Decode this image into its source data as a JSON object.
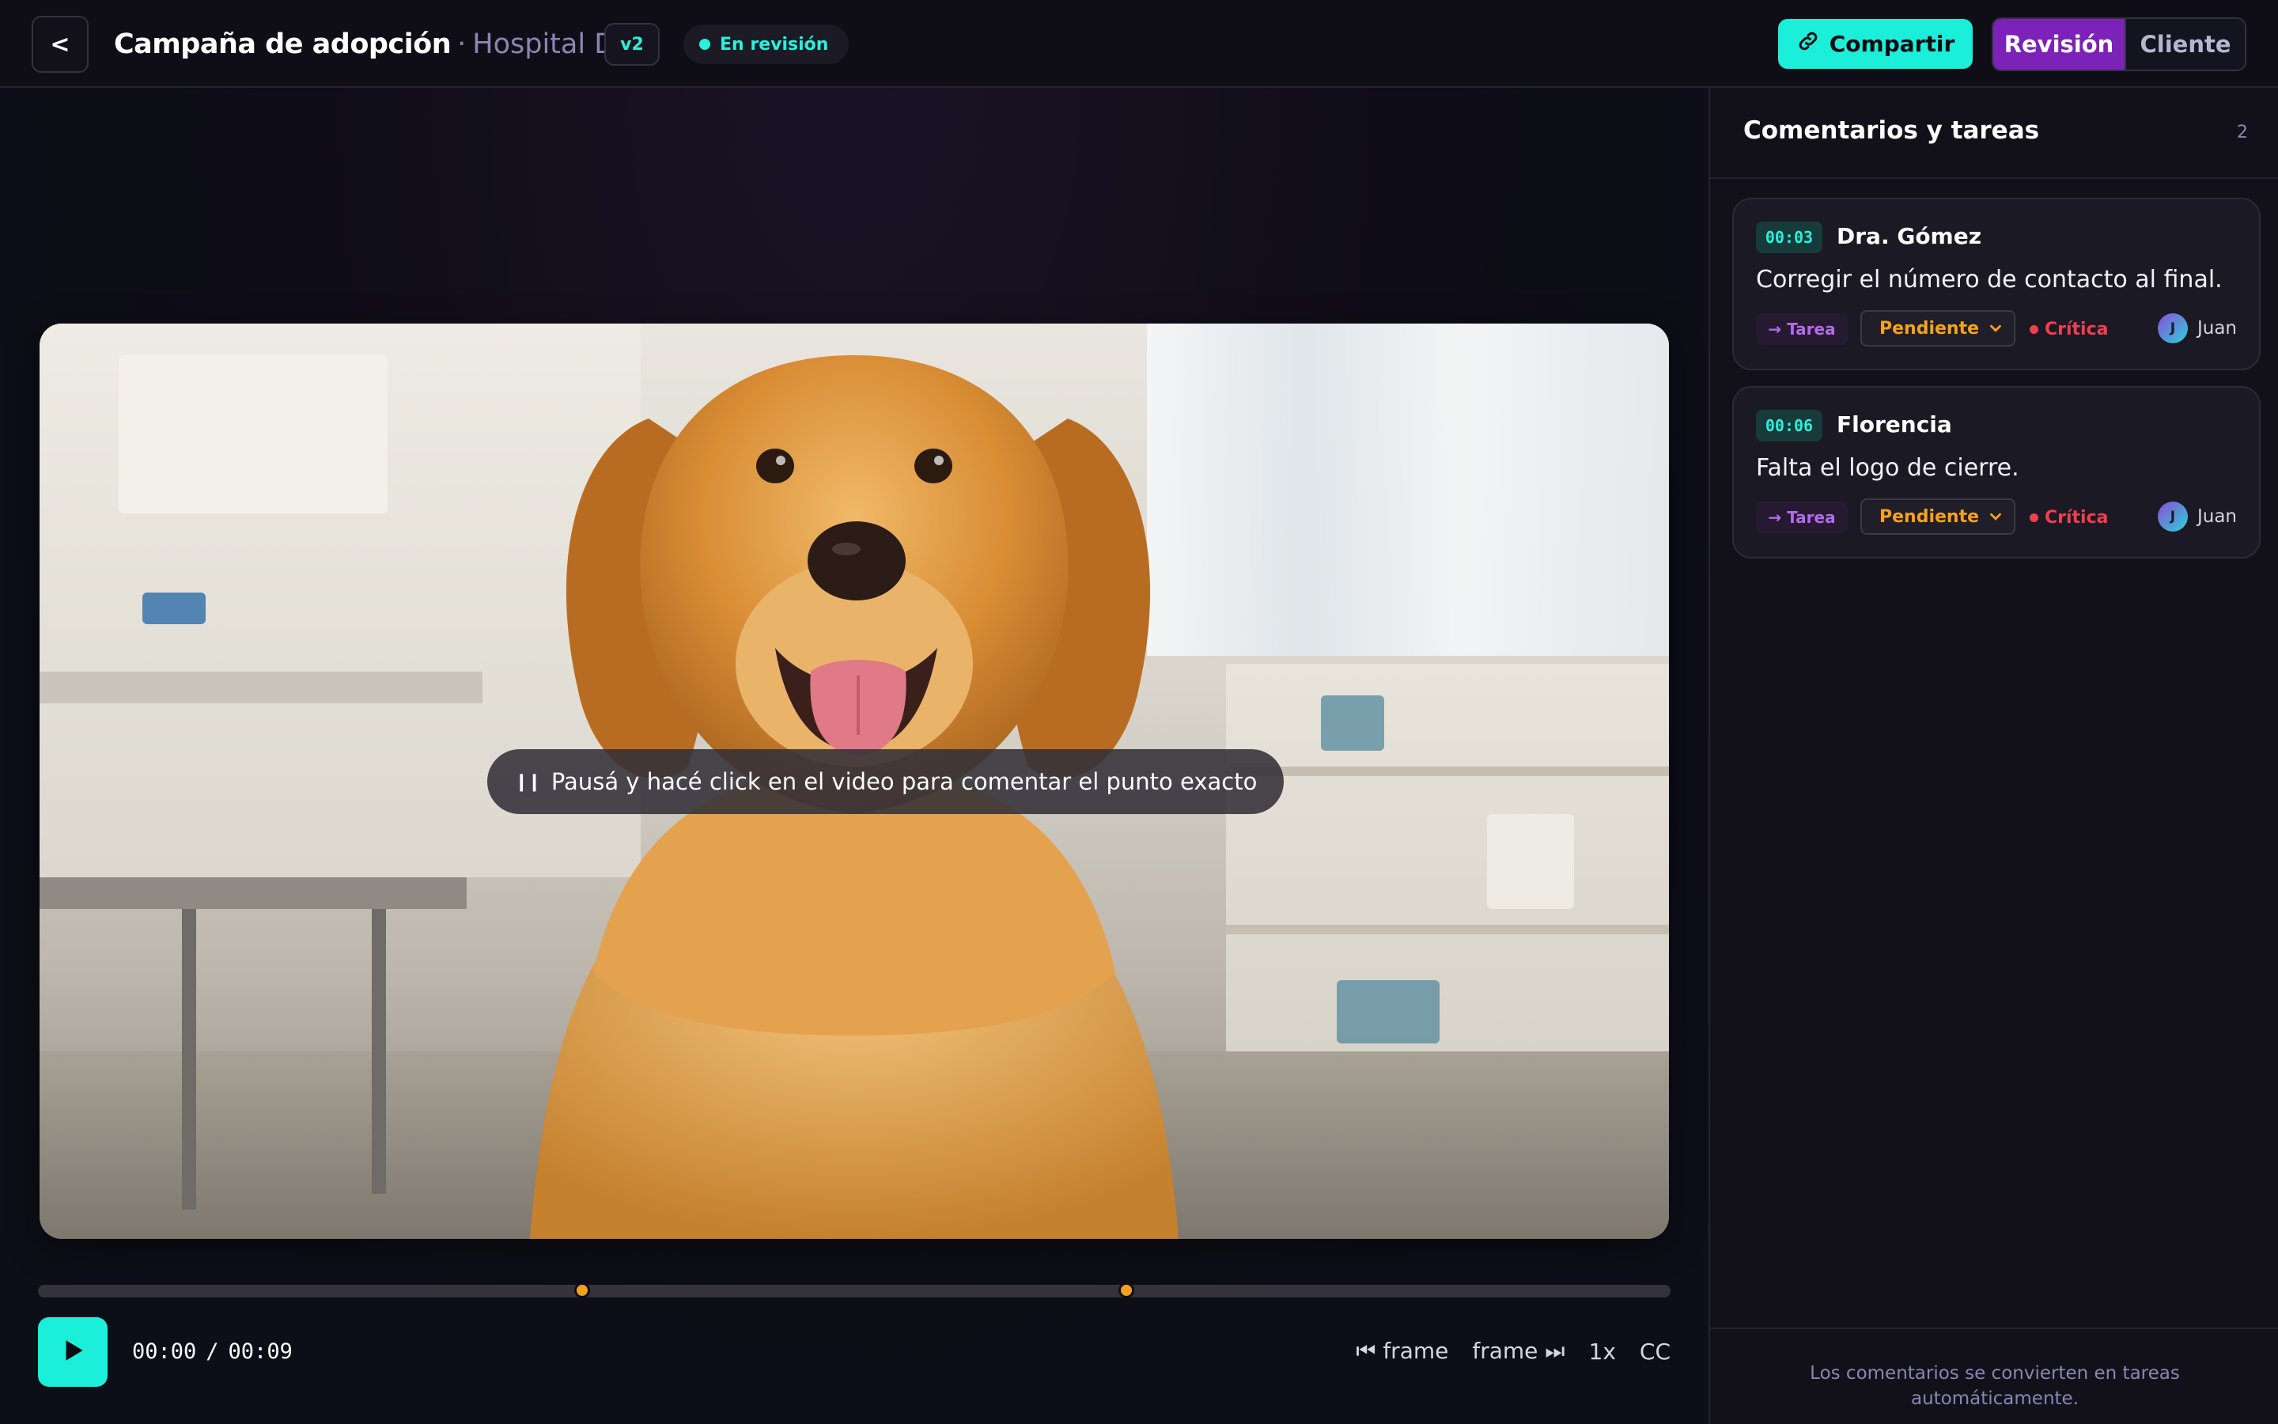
{
  "header": {
    "back_label": "<",
    "project_title": "Campaña de adopción",
    "separator": "·",
    "client_name": "Hospital Dog",
    "version": "v2",
    "status": "En revisión",
    "share_label": "Compartir",
    "modes": [
      "Revisión",
      "Cliente"
    ],
    "active_mode": "Revisión"
  },
  "player": {
    "hint": "Pausá y hacé click en el video para comentar el punto exacto",
    "current_time": "00:00",
    "time_separator": "/",
    "duration": "00:09",
    "prev_frame_label": "⏮ frame",
    "next_frame_label": "frame ⏭",
    "speed": "1x",
    "captions": "CC",
    "markers_seconds": [
      3,
      6
    ],
    "duration_seconds": 9
  },
  "sidebar": {
    "title": "Comentarios y tareas",
    "count": "2",
    "comments": [
      {
        "timestamp": "00:03",
        "author": "Dra. Gómez",
        "text": "Corregir el número de contacto al final.",
        "type": "→ Tarea",
        "status": "Pendiente",
        "priority": "Crítica",
        "assignee_initial": "J",
        "assignee": "Juan"
      },
      {
        "timestamp": "00:06",
        "author": "Florencia",
        "text": "Falta el logo de cierre.",
        "type": "→ Tarea",
        "status": "Pendiente",
        "priority": "Crítica",
        "assignee_initial": "J",
        "assignee": "Juan"
      }
    ],
    "footer_note": "Los comentarios se convierten en tareas automáticamente."
  },
  "colors": {
    "accent": "#1cefd9",
    "mode_active": "#7d22b8",
    "status_pending": "#f5a11e",
    "priority_critical": "#ef3f4f",
    "background": "#0e0d16"
  }
}
